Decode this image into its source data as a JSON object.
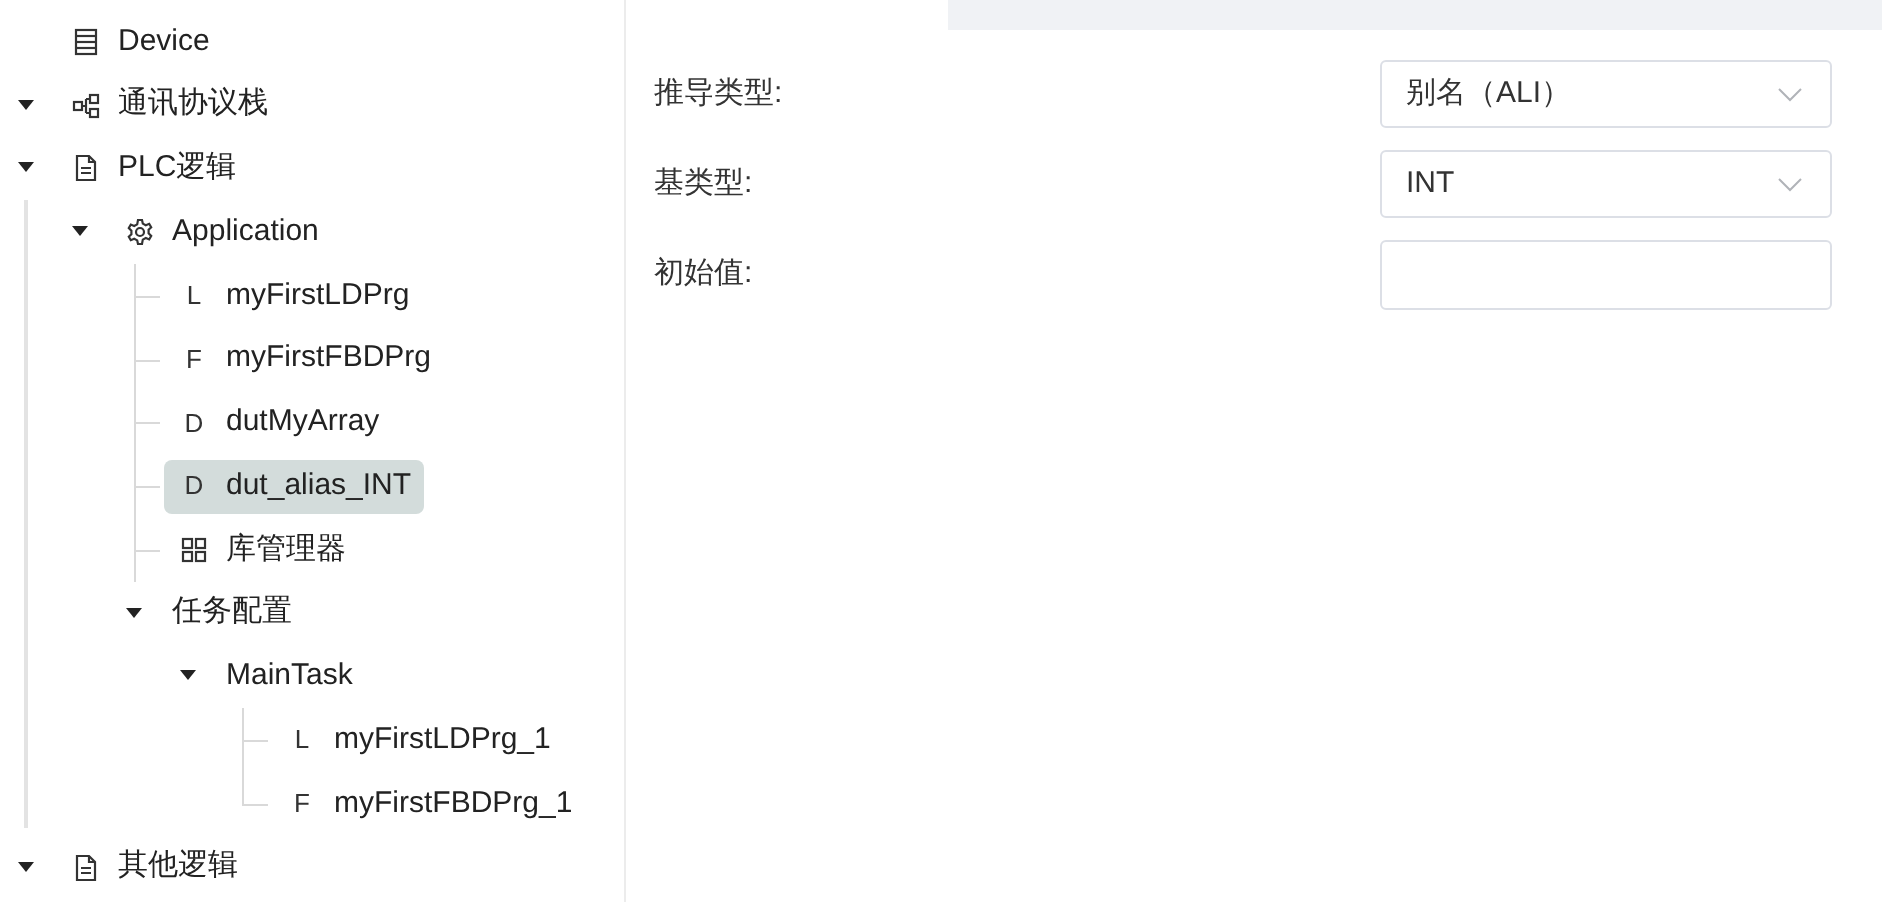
{
  "tree": [
    {
      "kind": "device",
      "label": "Device",
      "selected": false
    },
    {
      "kind": "network",
      "label": "通讯协议栈",
      "expanded": true,
      "selected": false
    },
    {
      "kind": "document",
      "label": "PLC逻辑",
      "expanded": true,
      "selected": false,
      "children": [
        {
          "kind": "settings",
          "label": "Application",
          "expanded": true,
          "selected": false,
          "children": [
            {
              "kind": "letter",
              "label": "myFirstLDPrg",
              "badge": "L",
              "selected": false
            },
            {
              "kind": "letter",
              "label": "myFirstFBDPrg",
              "badge": "F",
              "selected": false
            },
            {
              "kind": "letter",
              "label": "dutMyArray",
              "badge": "D",
              "selected": false
            },
            {
              "kind": "letter",
              "label": "dut_alias_INT",
              "badge": "D",
              "selected": true
            },
            {
              "kind": "grid",
              "label": "库管理器",
              "selected": false
            },
            {
              "kind": "plain",
              "label": "任务配置",
              "expanded": true,
              "selected": false,
              "children": [
                {
                  "kind": "plain",
                  "label": "MainTask",
                  "expanded": true,
                  "selected": false,
                  "children": [
                    {
                      "kind": "letter",
                      "label": "myFirstLDPrg_1",
                      "badge": "L",
                      "selected": false
                    },
                    {
                      "kind": "letter",
                      "label": "myFirstFBDPrg_1",
                      "badge": "F",
                      "selected": false
                    }
                  ]
                }
              ]
            }
          ]
        }
      ]
    },
    {
      "kind": "document",
      "label": "其他逻辑",
      "expanded": true,
      "selected": false
    }
  ],
  "form": [
    {
      "kind": "select",
      "label": "推导类型:",
      "value": "别名（ALI）"
    },
    {
      "kind": "select",
      "label": "基类型:",
      "value": "INT"
    },
    {
      "kind": "input",
      "label": "初始值:"
    }
  ]
}
